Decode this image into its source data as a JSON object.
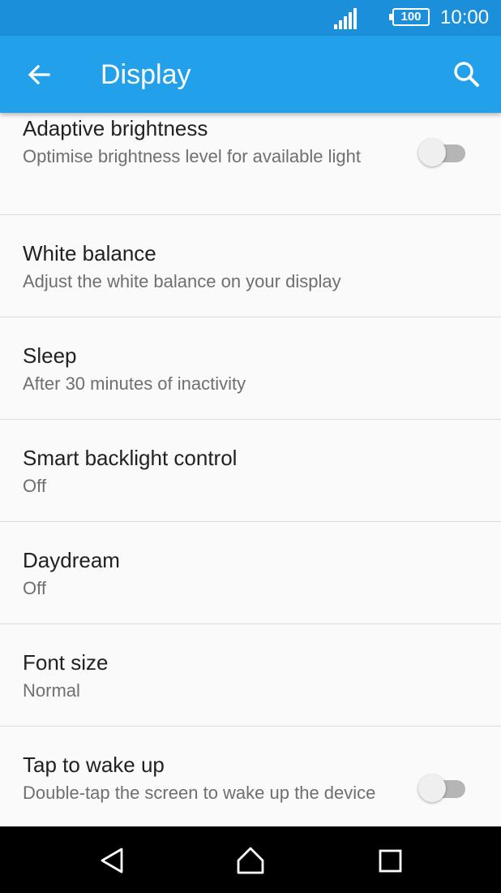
{
  "status_bar": {
    "battery": "100",
    "time": "10:00"
  },
  "app_bar": {
    "title": "Display"
  },
  "settings": {
    "adaptive_brightness": {
      "title": "Adaptive brightness",
      "summary": "Optimise brightness level for available light",
      "enabled": false
    },
    "white_balance": {
      "title": "White balance",
      "summary": "Adjust the white balance on your display"
    },
    "sleep": {
      "title": "Sleep",
      "summary": "After 30 minutes of inactivity"
    },
    "smart_backlight": {
      "title": "Smart backlight control",
      "summary": "Off"
    },
    "daydream": {
      "title": "Daydream",
      "summary": "Off"
    },
    "font_size": {
      "title": "Font size",
      "summary": "Normal"
    },
    "tap_to_wake": {
      "title": "Tap to wake up",
      "summary": "Double-tap the screen to wake up the device",
      "enabled": false
    }
  },
  "colors": {
    "status_bar": "#1b8fd9",
    "app_bar": "#22a0ea",
    "background": "#fafafa"
  },
  "icons": {
    "back": "arrow-left",
    "search": "magnifier",
    "nav_back": "triangle-left",
    "nav_home": "house-outline",
    "nav_recents": "square-outline"
  }
}
